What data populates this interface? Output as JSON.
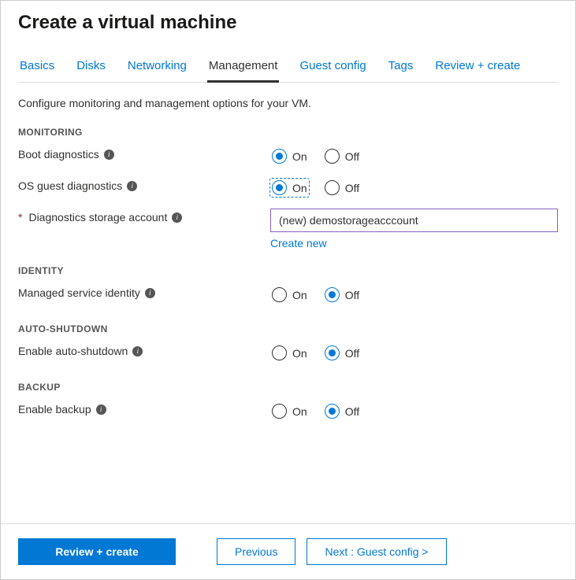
{
  "page": {
    "title": "Create a virtual machine",
    "description": "Configure monitoring and management options for your VM."
  },
  "tabs": [
    {
      "label": "Basics",
      "active": false
    },
    {
      "label": "Disks",
      "active": false
    },
    {
      "label": "Networking",
      "active": false
    },
    {
      "label": "Management",
      "active": true
    },
    {
      "label": "Guest config",
      "active": false
    },
    {
      "label": "Tags",
      "active": false
    },
    {
      "label": "Review + create",
      "active": false
    }
  ],
  "sections": {
    "monitoring": {
      "title": "MONITORING",
      "boot_diagnostics": {
        "label": "Boot diagnostics",
        "value": "On",
        "options": [
          "On",
          "Off"
        ]
      },
      "os_guest_diagnostics": {
        "label": "OS guest diagnostics",
        "value": "On",
        "options": [
          "On",
          "Off"
        ],
        "focused": true
      },
      "storage_account": {
        "label": "Diagnostics storage account",
        "required": true,
        "value": "(new) demostorageacccount",
        "create_link": "Create new"
      }
    },
    "identity": {
      "title": "IDENTITY",
      "managed_service_identity": {
        "label": "Managed service identity",
        "value": "Off",
        "options": [
          "On",
          "Off"
        ]
      }
    },
    "auto_shutdown": {
      "title": "AUTO-SHUTDOWN",
      "enable_auto_shutdown": {
        "label": "Enable auto-shutdown",
        "value": "Off",
        "options": [
          "On",
          "Off"
        ]
      }
    },
    "backup": {
      "title": "BACKUP",
      "enable_backup": {
        "label": "Enable backup",
        "value": "Off",
        "options": [
          "On",
          "Off"
        ]
      }
    }
  },
  "footer": {
    "primary": "Review + create",
    "previous": "Previous",
    "next": "Next : Guest config >"
  },
  "radio_labels": {
    "on": "On",
    "off": "Off"
  }
}
